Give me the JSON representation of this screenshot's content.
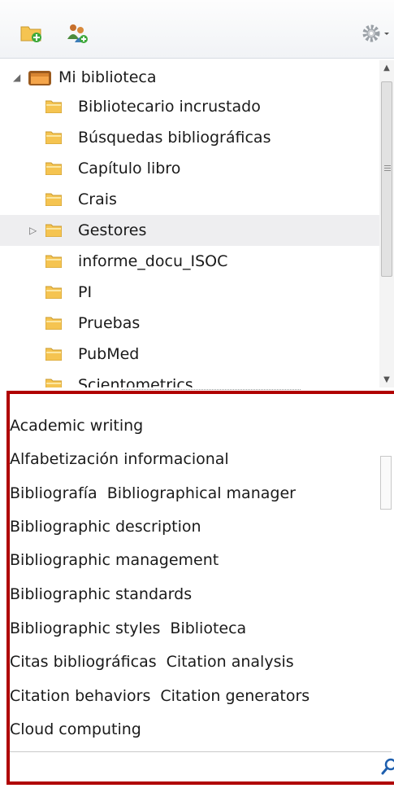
{
  "toolbar": {
    "new_collection_icon": "folder-add-icon",
    "new_group_icon": "group-add-icon",
    "actions_icon": "gear-icon",
    "colors": {
      "folder": "#f5c451",
      "folder_plus": "#3fa93b",
      "group": "#c76f2b",
      "gear": "#9aa0a6"
    }
  },
  "tree": {
    "root": {
      "label": "Mi biblioteca",
      "icon": "library-icon"
    },
    "items": [
      {
        "label": "Bibliotecario incrustado"
      },
      {
        "label": "Búsquedas bibliográficas"
      },
      {
        "label": "Capítulo libro"
      },
      {
        "label": "Crais"
      },
      {
        "label": "Gestores",
        "has_children": true,
        "selected": true
      },
      {
        "label": "informe_docu_ISOC"
      },
      {
        "label": "PI"
      },
      {
        "label": "Pruebas"
      },
      {
        "label": "PubMed"
      },
      {
        "label": "Scientometrics"
      }
    ]
  },
  "tags": {
    "lines": [
      [
        "Academic writing"
      ],
      [
        "Alfabetización informacional"
      ],
      [
        "Bibliografía",
        "Bibliographical manager"
      ],
      [
        "Bibliographic description"
      ],
      [
        "Bibliographic management"
      ],
      [
        "Bibliographic standards"
      ],
      [
        "Bibliographic styles",
        "Biblioteca"
      ],
      [
        "Citas bibliográficas",
        "Citation analysis"
      ],
      [
        "Citation behaviors",
        "Citation generators"
      ],
      [
        "Cloud computing"
      ]
    ],
    "filter_value": "",
    "highlight_color": "#b00000"
  }
}
